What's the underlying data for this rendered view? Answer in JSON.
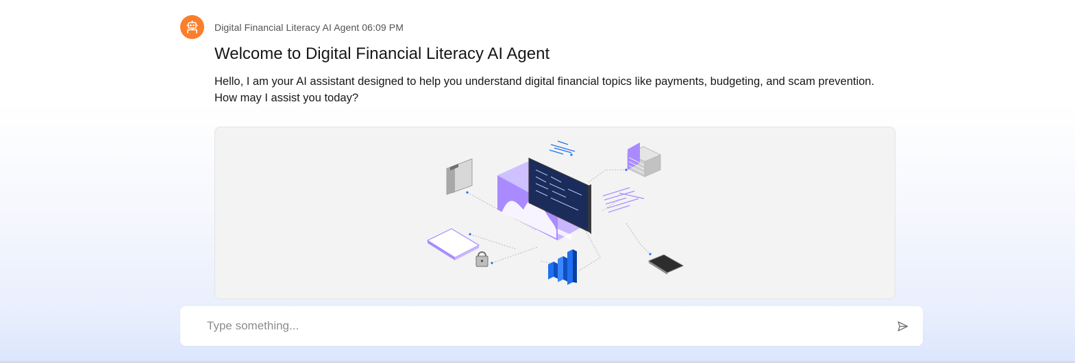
{
  "message": {
    "agent_name": "Digital Financial Literacy AI Agent",
    "timestamp": "06:09 PM",
    "title": "Welcome to Digital Financial Literacy AI Agent",
    "body": "Hello, I am your AI assistant designed to help you understand digital financial topics like payments, budgeting, and scam prevention. How may I assist you today?",
    "avatar_icon": "robot-icon",
    "avatar_color": "#fb7e2a"
  },
  "illustration": {
    "icon": "data-network-illustration",
    "accent_purple": "#a98bff",
    "accent_blue": "#1f70f0"
  },
  "composer": {
    "placeholder": "Type something...",
    "value": "",
    "send_icon": "send-icon"
  }
}
